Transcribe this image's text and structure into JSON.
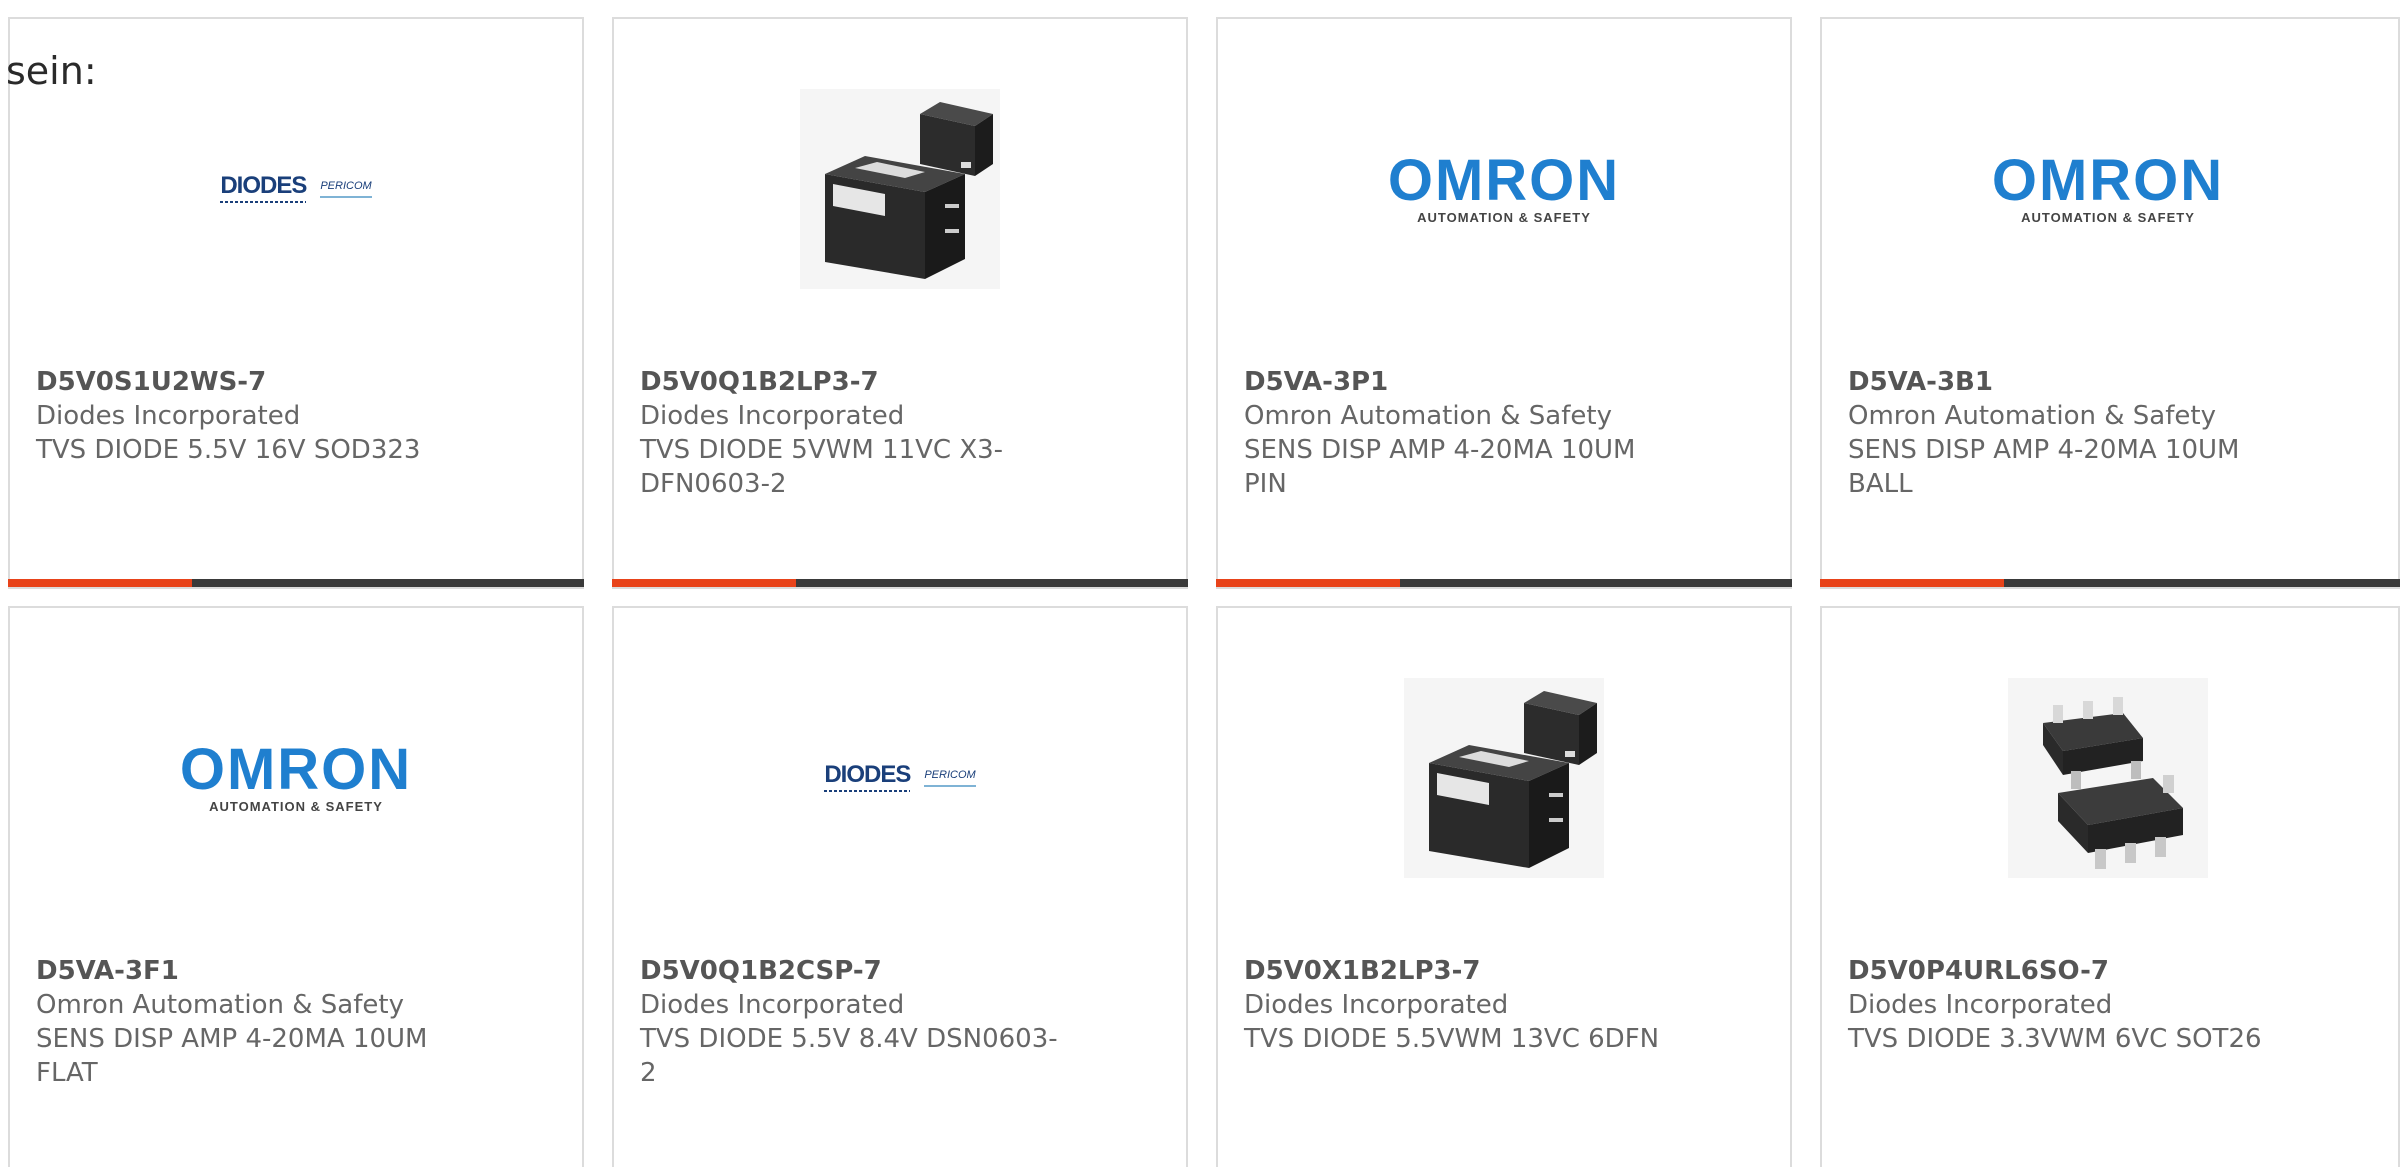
{
  "intro_text": "sein:",
  "colors": {
    "accent": "#e8431a",
    "bar": "#3a3a3a",
    "omron_blue": "#1f7fcf",
    "diodes_blue": "#1a3f7a"
  },
  "logos": {
    "diodes": {
      "word": "DIODES",
      "sub": "PERICOM"
    },
    "omron": {
      "word": "OMRON",
      "sub": "AUTOMATION & SAFETY"
    }
  },
  "products": [
    {
      "part": "D5V0S1U2WS-7",
      "manufacturer": "Diodes Incorporated",
      "desc_line1": "TVS DIODE 5.5V 16V SOD323",
      "desc_line2": "",
      "image": "diodes-logo"
    },
    {
      "part": "D5V0Q1B2LP3-7",
      "manufacturer": "Diodes Incorporated",
      "desc_line1": "TVS DIODE 5VWM 11VC X3-",
      "desc_line2": "DFN0603-2",
      "image": "dfn-package-icon"
    },
    {
      "part": "D5VA-3P1",
      "manufacturer": "Omron Automation & Safety",
      "desc_line1": "SENS DISP AMP 4-20MA 10UM",
      "desc_line2": "PIN",
      "image": "omron-logo"
    },
    {
      "part": "D5VA-3B1",
      "manufacturer": "Omron Automation & Safety",
      "desc_line1": "SENS DISP AMP 4-20MA 10UM",
      "desc_line2": "BALL",
      "image": "omron-logo"
    },
    {
      "part": "D5VA-3F1",
      "manufacturer": "Omron Automation & Safety",
      "desc_line1": "SENS DISP AMP 4-20MA 10UM",
      "desc_line2": "FLAT",
      "image": "omron-logo"
    },
    {
      "part": "D5V0Q1B2CSP-7",
      "manufacturer": "Diodes Incorporated",
      "desc_line1": "TVS DIODE 5.5V 8.4V DSN0603-2",
      "desc_line2": "",
      "image": "diodes-logo"
    },
    {
      "part": "D5V0X1B2LP3-7",
      "manufacturer": "Diodes Incorporated",
      "desc_line1": "TVS DIODE 5.5VWM 13VC 6DFN",
      "desc_line2": "",
      "image": "dfn-package-icon"
    },
    {
      "part": "D5V0P4URL6SO-7",
      "manufacturer": "Diodes Incorporated",
      "desc_line1": "TVS DIODE 3.3VWM 6VC SOT26",
      "desc_line2": "",
      "image": "sot26-package-icon"
    }
  ]
}
